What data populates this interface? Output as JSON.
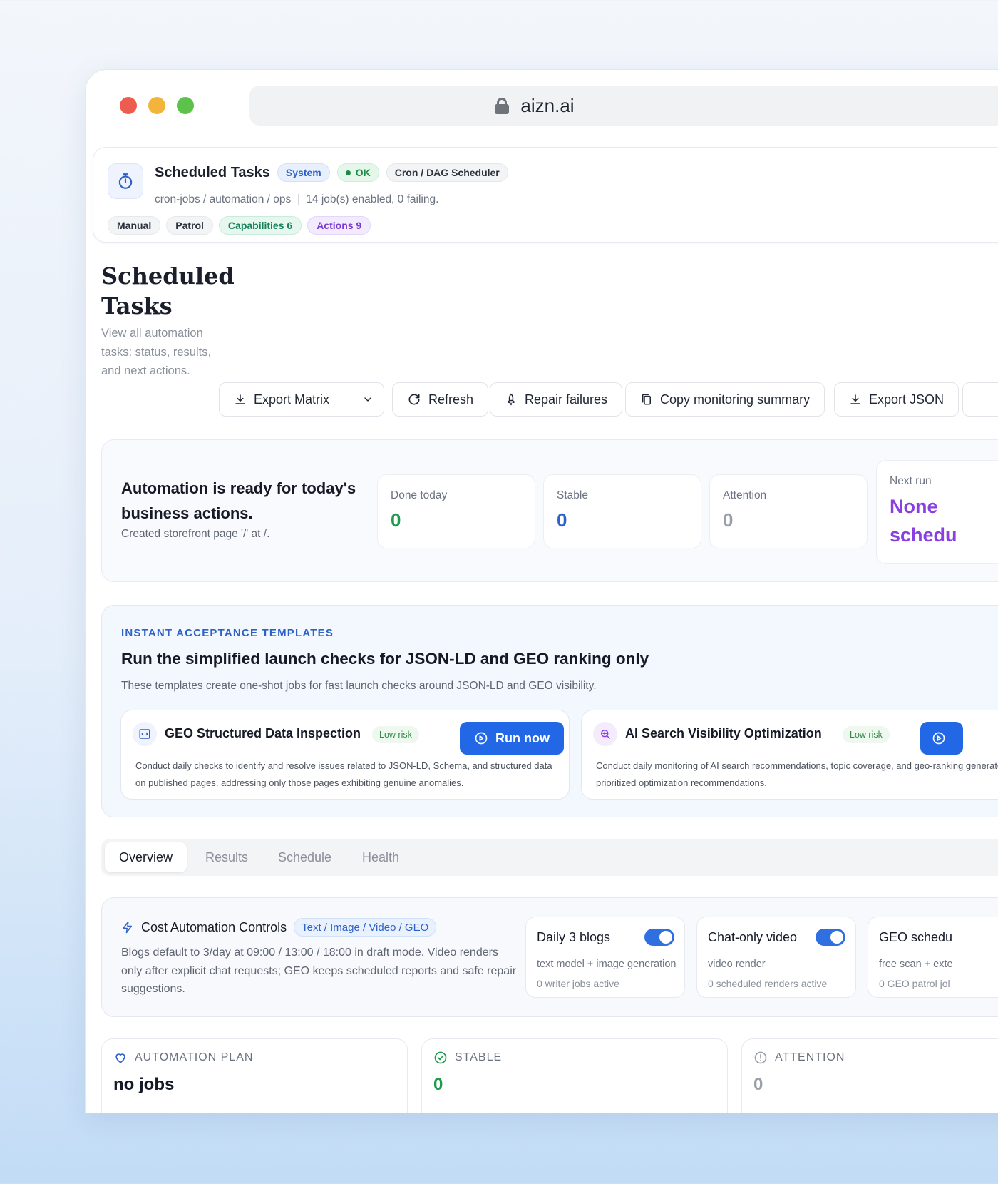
{
  "browser": {
    "url": "aizn.ai"
  },
  "header": {
    "title": "Scheduled Tasks",
    "badge_system": "System",
    "badge_ok": "OK",
    "badge_cron": "Cron / DAG Scheduler",
    "path": "cron-jobs / automation / ops",
    "summary": "14 job(s) enabled, 0 failing.",
    "tags": {
      "manual": "Manual",
      "patrol": "Patrol",
      "capabilities": "Capabilities 6",
      "actions": "Actions 9"
    }
  },
  "page": {
    "title": "Scheduled Tasks",
    "description": "View all automation tasks: status, results, and next actions."
  },
  "toolbar": {
    "export_matrix": "Export Matrix",
    "refresh": "Refresh",
    "repair": "Repair failures",
    "copy_summary": "Copy monitoring summary",
    "export_json": "Export JSON"
  },
  "status": {
    "headline": "Automation is ready for today's business actions.",
    "sub": "Created storefront page '/' at /.",
    "done_label": "Done today",
    "done_value": "0",
    "stable_label": "Stable",
    "stable_value": "0",
    "attention_label": "Attention",
    "attention_value": "0",
    "next_label": "Next run",
    "next_value": "None schedu"
  },
  "templates": {
    "eyebrow": "INSTANT ACCEPTANCE TEMPLATES",
    "title": "Run the simplified launch checks for JSON-LD and GEO ranking only",
    "sub": "These templates create one-shot jobs for fast launch checks around JSON-LD and GEO visibility.",
    "cards": [
      {
        "name": "GEO Structured Data Inspection",
        "risk": "Low risk",
        "run": "Run now",
        "desc": "Conduct daily checks to identify and resolve issues related to JSON-LD, Schema, and structured data on published pages, addressing only those pages exhibiting genuine anomalies."
      },
      {
        "name": "AI Search Visibility Optimization",
        "risk": "Low risk",
        "desc": "Conduct daily monitoring of AI search recommendations, topic coverage, and geo-ranking generate prioritized optimization recommendations."
      }
    ]
  },
  "tabs": [
    "Overview",
    "Results",
    "Schedule",
    "Health"
  ],
  "cost": {
    "title": "Cost Automation Controls",
    "modes": "Text / Image / Video / GEO",
    "body": "Blogs default to 3/day at 09:00 / 13:00 / 18:00 in draft mode. Video renders only after explicit chat requests; GEO keeps scheduled reports and safe repair suggestions.",
    "cards": [
      {
        "title": "Daily 3 blogs",
        "line1": "text model + image generation",
        "line2": "0 writer jobs active"
      },
      {
        "title": "Chat-only video",
        "line1": "video render",
        "line2": "0 scheduled renders active"
      },
      {
        "title": "GEO schedu",
        "line1": "free scan + exte",
        "line2": "0 GEO patrol jol"
      }
    ]
  },
  "bottom": {
    "plan_label": "AUTOMATION PLAN",
    "plan_value": "no jobs",
    "stable_label": "STABLE",
    "stable_value": "0",
    "attention_label": "ATTENTION",
    "attention_value": "0"
  },
  "colors": {
    "accent": "#2267e6",
    "success": "#1e8a45",
    "purple": "#8a3fe3"
  }
}
